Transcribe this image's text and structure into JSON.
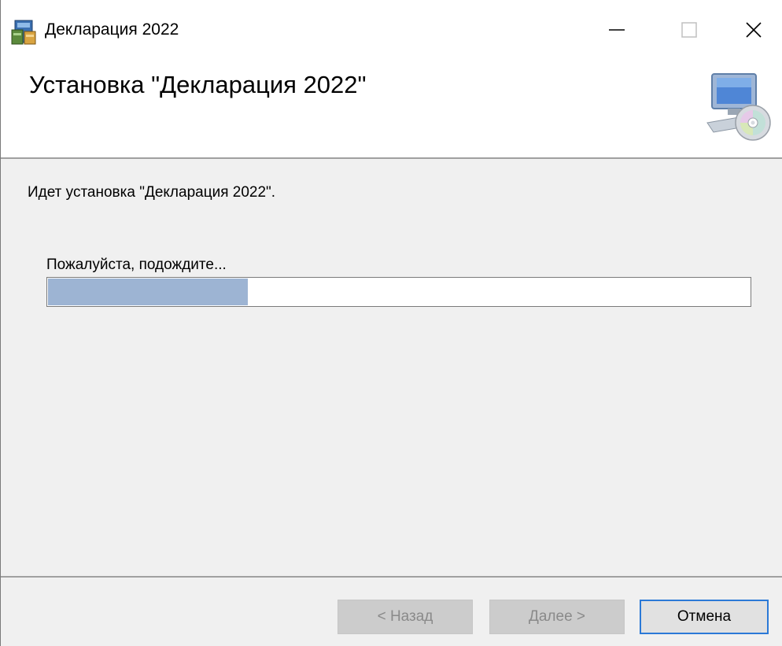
{
  "window": {
    "title": "Декларация 2022",
    "icons": {
      "app": "installer-app-icon",
      "minimize": "minimize-icon",
      "maximize": "maximize-icon",
      "close": "close-icon"
    }
  },
  "header": {
    "title": "Установка \"Декларация 2022\"",
    "graphic": "computer-cd-setup-icon"
  },
  "content": {
    "status_text": "Идет установка \"Декларация 2022\".",
    "wait_text": "Пожалуйста, подождите...",
    "progress": 0.285,
    "progress_color": "#9db4d3"
  },
  "footer": {
    "back_label": "< Назад",
    "next_label": "Далее >",
    "cancel_label": "Отмена"
  },
  "colors": {
    "content_bg": "#f0f0f0",
    "focus_border": "#2b79d7"
  }
}
